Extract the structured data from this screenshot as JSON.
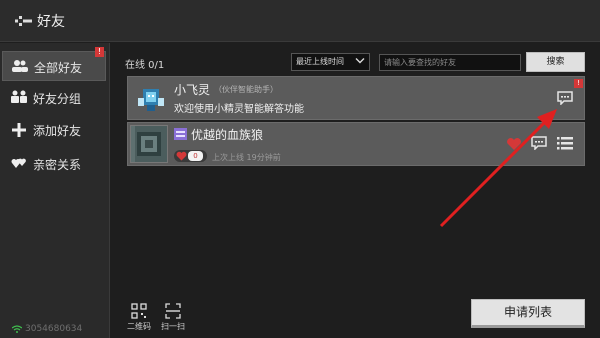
{
  "header": {
    "title": "好友"
  },
  "sidebar": {
    "items": [
      {
        "label": "全部好友",
        "badge": "!",
        "icon": "people-icon",
        "active": true
      },
      {
        "label": "好友分组",
        "icon": "group-icon"
      },
      {
        "label": "添加好友",
        "icon": "plus-icon"
      },
      {
        "label": "亲密关系",
        "icon": "hearts-icon"
      }
    ],
    "footer_id": "3054680634"
  },
  "main": {
    "online_count": "在线 0/1",
    "sort_select": "最近上线时间",
    "search_placeholder": "请输入要查找的好友",
    "search_button": "搜索",
    "friends": [
      {
        "name": "小飞灵",
        "tag": "（伙伴智能助手）",
        "message": "欢迎使用小精灵智能解答功能",
        "badge": "!"
      },
      {
        "name": "优越的血族狼",
        "intimacy": "0",
        "last_online": "上次上线 19分钟前"
      }
    ],
    "bottom": {
      "qrcode_label": "二维码",
      "scan_label": "扫一扫",
      "apply_list_button": "申请列表"
    }
  },
  "colors": {
    "accent_red": "#d43838",
    "arrow_red": "#e02020"
  }
}
